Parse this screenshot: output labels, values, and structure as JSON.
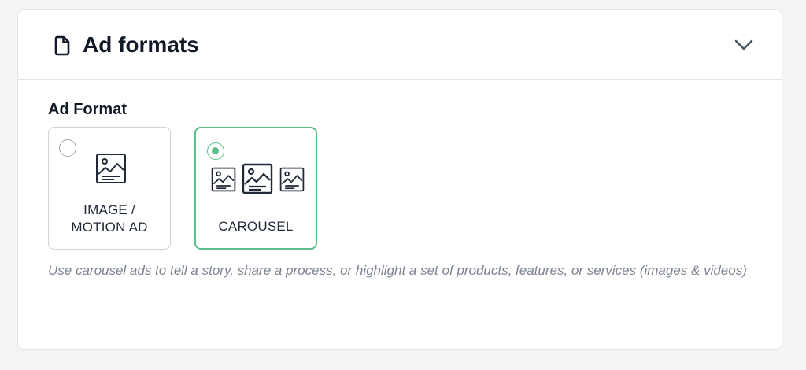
{
  "panel": {
    "title": "Ad formats",
    "title_icon": "document-icon",
    "toggle_icon": "chevron-down-icon"
  },
  "ad_format": {
    "label": "Ad Format",
    "options": [
      {
        "label_line1": "IMAGE /",
        "label_line2": "MOTION AD",
        "icon": "image-icon",
        "selected": false
      },
      {
        "label": "CAROUSEL",
        "icon": "carousel-icon",
        "selected": true
      }
    ],
    "help_text": "Use carousel ads to tell a story, share a process, or highlight a set of products, features, or services (images & videos)"
  },
  "colors": {
    "accent": "#58c187",
    "text_primary": "#111827",
    "text_muted": "#7b8391",
    "border": "#e2e5ea"
  }
}
